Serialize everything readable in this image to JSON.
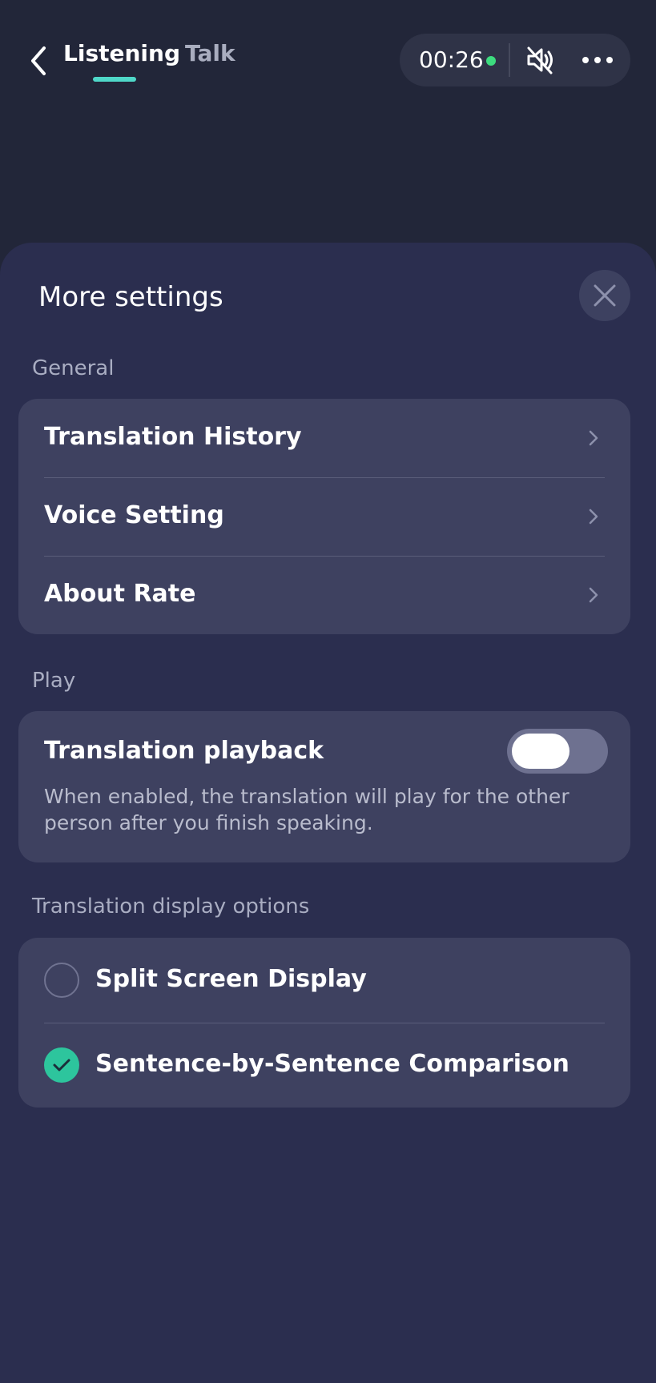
{
  "header": {
    "tabs": [
      {
        "label": "Listening",
        "active": true
      },
      {
        "label": "Talk",
        "active": false
      }
    ],
    "timer": "00:26",
    "icons": {
      "back": "chevron-left-icon",
      "mute": "speaker-muted-icon",
      "more": "more-horizontal-icon",
      "recording": "recording-dot"
    },
    "colors": {
      "accent": "#4fd8c9",
      "recording": "#3ddc7f"
    }
  },
  "sheet": {
    "title": "More settings",
    "close_icon": "close-icon",
    "general": {
      "label": "General",
      "items": [
        {
          "label": "Translation History"
        },
        {
          "label": "Voice Setting"
        },
        {
          "label": "About Rate"
        }
      ]
    },
    "play": {
      "label": "Play",
      "playback": {
        "title": "Translation playback",
        "description": "When enabled, the translation will play for the other person after you finish speaking.",
        "enabled": false
      }
    },
    "display": {
      "label": "Translation display options",
      "options": [
        {
          "label": "Split Screen Display",
          "selected": false
        },
        {
          "label": "Sentence-by-Sentence Comparison",
          "selected": true
        }
      ],
      "selected_color": "#2dc59d"
    }
  }
}
